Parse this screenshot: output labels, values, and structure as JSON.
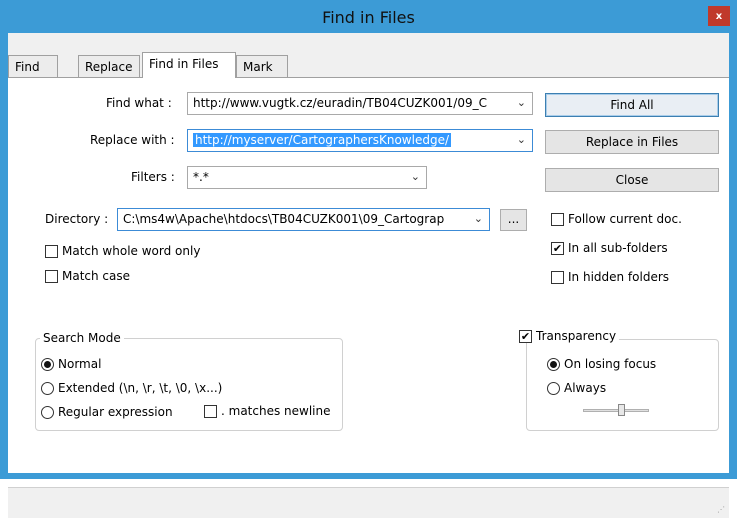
{
  "window": {
    "title": "Find in Files",
    "close_label": "x"
  },
  "tabs": [
    {
      "label": "Find"
    },
    {
      "label": "Replace"
    },
    {
      "label": "Find in Files"
    },
    {
      "label": "Mark"
    }
  ],
  "fields": {
    "find_label": "Find what :",
    "find_value": "http://www.vugtk.cz/euradin/TB04CUZK001/09_C",
    "replace_label": "Replace with :",
    "replace_value": "http://myserver/CartographersKnowledge/",
    "filters_label": "Filters :",
    "filters_value": "*.*",
    "directory_label": "Directory :",
    "directory_value": "C:\\ms4w\\Apache\\htdocs\\TB04CUZK001\\09_Cartograp",
    "browse_label": "..."
  },
  "buttons": {
    "find_all": "Find All",
    "replace_in_files": "Replace in Files",
    "close": "Close"
  },
  "options": {
    "follow_current": {
      "label": "Follow current doc.",
      "checked": false
    },
    "all_subfolders": {
      "label": "In all sub-folders",
      "checked": true
    },
    "hidden_folders": {
      "label": "In hidden folders",
      "checked": false
    },
    "match_whole": {
      "label": "Match whole word only",
      "checked": false
    },
    "match_case": {
      "label": "Match case",
      "checked": false
    }
  },
  "search_mode": {
    "title": "Search Mode",
    "normal": "Normal",
    "extended": "Extended (\\n, \\r, \\t, \\0, \\x...)",
    "regex": "Regular expression",
    "matches_newline": ". matches newline",
    "selected": "normal"
  },
  "transparency": {
    "label": "Transparency",
    "checked": true,
    "on_losing_focus": "On losing focus",
    "always": "Always",
    "selected": "on_losing_focus",
    "level": 0.6
  }
}
